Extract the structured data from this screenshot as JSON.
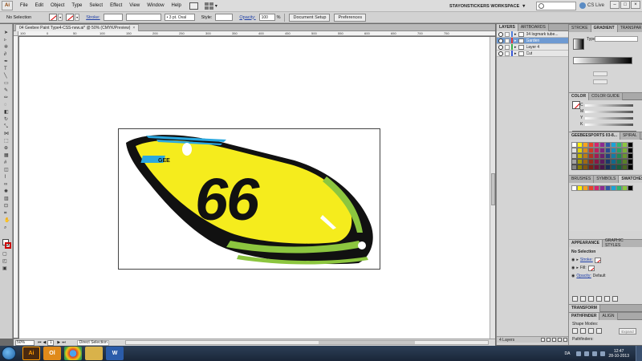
{
  "menubar": {
    "app_badge": "Ai",
    "items": [
      "File",
      "Edit",
      "Object",
      "Type",
      "Select",
      "Effect",
      "View",
      "Window",
      "Help"
    ],
    "workspace": "STAYONSTICKERS WORKSPACE",
    "cs_live": "CS Live",
    "window_controls": [
      "–",
      "□",
      "×"
    ]
  },
  "controlbar": {
    "selection": "No Selection",
    "stroke_label": "Stroke:",
    "brush": "• 3 pt. Oval",
    "style_label": "Style:",
    "opacity_label": "Opacity:",
    "opacity_value": "100",
    "opacity_unit": "%",
    "document_setup": "Document Setup",
    "preferences": "Preferences"
  },
  "document": {
    "tab_title": "04 Geebee Paint Type4-CSS-new.ai* @ 50% (CMYK/Preview)",
    "close": "×",
    "ruler_ticks": [
      "100",
      "0",
      "50",
      "100",
      "150",
      "200",
      "250",
      "300",
      "350",
      "400",
      "450",
      "500",
      "550",
      "600",
      "650",
      "700",
      "750"
    ]
  },
  "status": {
    "zoom": "50%",
    "page": "1",
    "tool": "Direct Selection"
  },
  "layers": {
    "tabs": [
      "LAYERS",
      "ARTBOARDS"
    ],
    "rows": [
      {
        "name": "04 logmark tube...",
        "color": "#4f7fdd",
        "selected": false
      },
      {
        "name": "Garden",
        "color": "#e03a3a",
        "selected": true
      },
      {
        "name": "Layer 4",
        "color": "#3bb24a",
        "selected": false
      },
      {
        "name": "Cut",
        "color": "#3a5bd8",
        "selected": false
      }
    ],
    "footer": "4 Layers"
  },
  "right_dock": {
    "gradient_tabs": [
      "STROKE",
      "GRADIENT",
      "TRANSPAR"
    ],
    "gradient_type_label": "Type:",
    "color_tabs": [
      "COLOR",
      "COLOR GUIDE"
    ],
    "color_channels": [
      "C",
      "M",
      "Y",
      "K"
    ],
    "swatch_tabs": [
      "GEEBEESPORTS 03-8...",
      "SPIRAL"
    ],
    "library_tabs": [
      "BRUSHES",
      "SYMBOLS",
      "SWATCHES"
    ],
    "appearance_tabs": [
      "APPEARANCE",
      "GRAPHIC STYLES"
    ],
    "appearance_title": "No Selection",
    "stroke_label": "Stroke:",
    "fill_label": "Fill:",
    "opacity_label": "Opacity:",
    "opacity_value": "Default",
    "transform_tab": "TRANSFORM",
    "pathfinder_tabs": [
      "PATHFINDER",
      "ALIGN"
    ],
    "shape_modes": "Shape Modes:",
    "expand": "Expand",
    "pathfinders": "Pathfinders:"
  },
  "artwork": {
    "number": "66",
    "small_logo": "GEE",
    "colors": {
      "yellow": "#f5ec1d",
      "green": "#8cc63f",
      "blue": "#2aa8e0",
      "black": "#111111"
    }
  },
  "taskbar": {
    "apps": [
      "Ai",
      "Ol",
      "Ch",
      "Ex",
      "W"
    ],
    "language": "DA",
    "time": "12:47",
    "date": "28-10-2013"
  }
}
